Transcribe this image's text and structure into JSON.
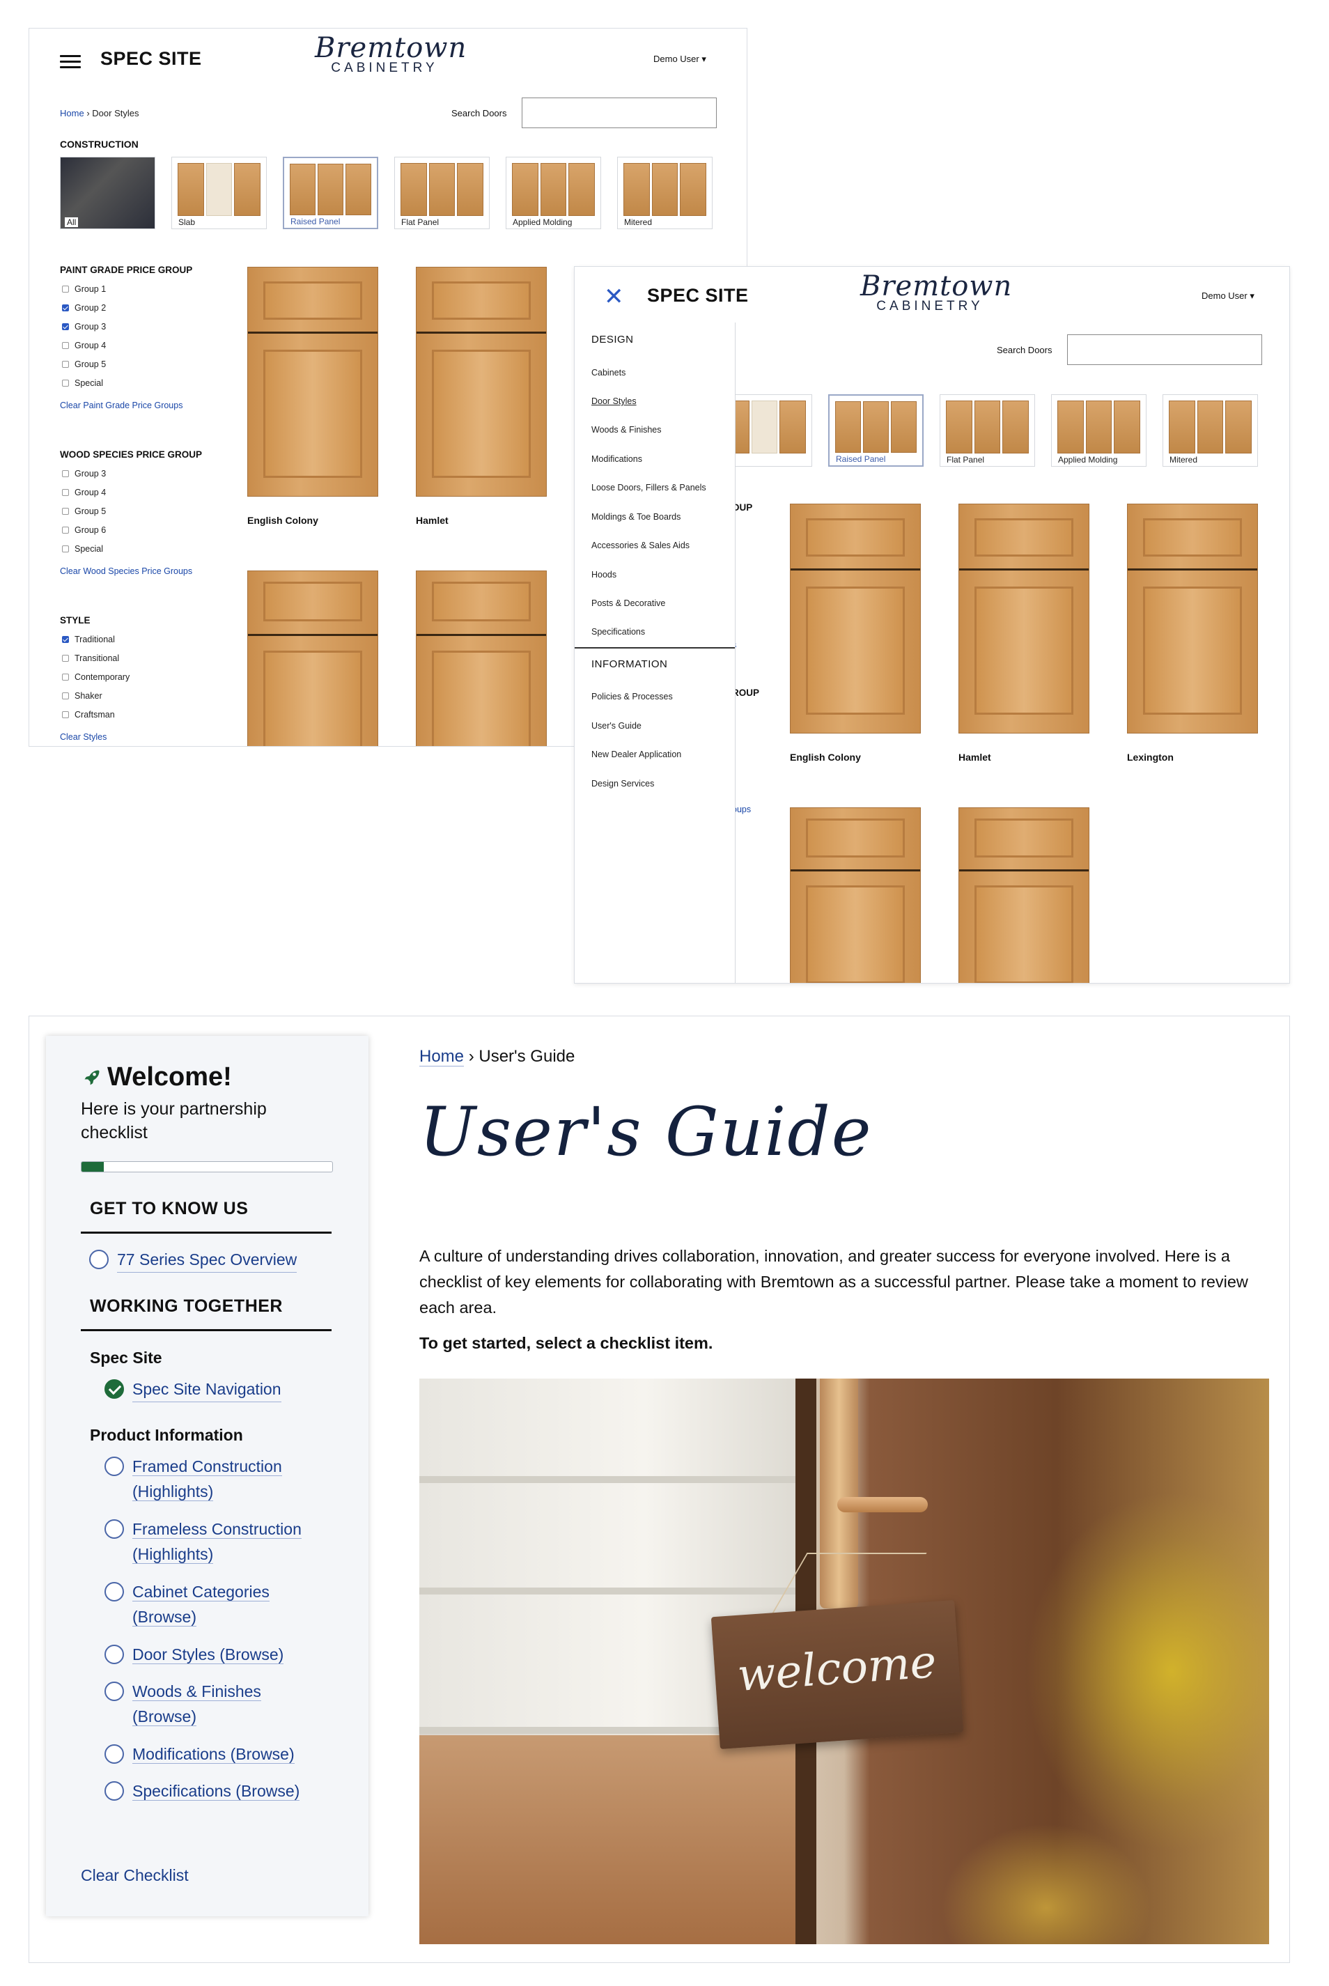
{
  "brand": {
    "site_title": "SPEC SITE",
    "logo_script": "Bremtown",
    "logo_sub": "CABINETRY",
    "user_menu": "Demo User ▾"
  },
  "door_styles_page": {
    "breadcrumb": {
      "home": "Home",
      "sep": "›",
      "current": "Door Styles"
    },
    "search_label": "Search Doors",
    "search_value": "",
    "construction_heading": "CONSTRUCTION",
    "construction_items": [
      {
        "label": "All",
        "selected": false
      },
      {
        "label": "Slab",
        "selected": false
      },
      {
        "label": "Raised Panel",
        "selected": true
      },
      {
        "label": "Flat Panel",
        "selected": false
      },
      {
        "label": "Applied Molding",
        "selected": false
      },
      {
        "label": "Mitered",
        "selected": false
      }
    ],
    "paint_grade": {
      "heading": "PAINT GRADE PRICE GROUP",
      "items": [
        {
          "label": "Group 1",
          "checked": false
        },
        {
          "label": "Group 2",
          "checked": true
        },
        {
          "label": "Group 3",
          "checked": true
        },
        {
          "label": "Group 4",
          "checked": false
        },
        {
          "label": "Group 5",
          "checked": false
        },
        {
          "label": "Special",
          "checked": false
        }
      ],
      "clear": "Clear Paint Grade Price Groups"
    },
    "wood_species": {
      "heading": "WOOD SPECIES PRICE GROUP",
      "items": [
        {
          "label": "Group 3",
          "checked": false
        },
        {
          "label": "Group 4",
          "checked": false
        },
        {
          "label": "Group 5",
          "checked": false
        },
        {
          "label": "Group 6",
          "checked": false
        },
        {
          "label": "Special",
          "checked": false
        }
      ],
      "clear": "Clear Wood Species Price Groups"
    },
    "style": {
      "heading": "STYLE",
      "items": [
        {
          "label": "Traditional",
          "checked": true
        },
        {
          "label": "Transitional",
          "checked": false
        },
        {
          "label": "Contemporary",
          "checked": false
        },
        {
          "label": "Shaker",
          "checked": false
        },
        {
          "label": "Craftsman",
          "checked": false
        }
      ],
      "clear": "Clear Styles"
    },
    "doors": [
      "English Colony",
      "Hamlet",
      "Lexington"
    ]
  },
  "menu_overlay": {
    "close_icon": "close-icon",
    "design_heading": "DESIGN",
    "design_items": [
      "Cabinets",
      "Door Styles",
      "Woods & Finishes",
      "Modifications",
      "Loose Doors, Fillers & Panels",
      "Moldings & Toe Boards",
      "Accessories & Sales Aids",
      "Hoods",
      "Posts & Decorative",
      "Specifications"
    ],
    "active_item": "Door Styles",
    "information_heading": "INFORMATION",
    "information_items": [
      "Policies & Processes",
      "User's Guide",
      "New Dealer Application",
      "Design Services"
    ],
    "peek": {
      "group_a": "OUP",
      "group_b": "ROUP",
      "link_a": "s",
      "link_b": "oups",
      "slab_tail": "ab"
    }
  },
  "users_guide": {
    "sidebar": {
      "title": "Welcome!",
      "subtitle": "Here is your partnership checklist",
      "progress_fraction": 0.09,
      "groups": [
        {
          "title": "GET TO KNOW US",
          "items": [
            {
              "label": "77 Series Spec Overview",
              "done": false
            }
          ]
        },
        {
          "title": "WORKING TOGETHER"
        }
      ],
      "spec_site_heading": "Spec Site",
      "spec_site_items": [
        {
          "label": "Spec Site Navigation",
          "done": true
        }
      ],
      "product_info_heading": "Product Information",
      "product_items": [
        {
          "label": "Framed Construction (Highlights)",
          "done": false
        },
        {
          "label": "Frameless Construction (Highlights)",
          "done": false
        },
        {
          "label": "Cabinet Categories (Browse)",
          "done": false
        },
        {
          "label": "Door Styles (Browse)",
          "done": false
        },
        {
          "label": "Woods & Finishes (Browse)",
          "done": false
        },
        {
          "label": "Modifications (Browse)",
          "done": false
        },
        {
          "label": "Specifications (Browse)",
          "done": false
        }
      ],
      "clear": "Clear Checklist"
    },
    "breadcrumb": {
      "home": "Home",
      "sep": "›",
      "current": "User's Guide"
    },
    "title": "User's Guide",
    "intro": "A culture of understanding drives collaboration, innovation, and greater success for everyone involved. Here is a checklist of key elements for collaborating with Bremtown as a successful partner. Please take a moment to review each area.",
    "cta": "To get started, select a checklist item.",
    "photo_sign": "welcome"
  },
  "colors": {
    "link": "#1a47a8",
    "check_green": "#1e6b3a",
    "brand_navy": "#14213d"
  }
}
